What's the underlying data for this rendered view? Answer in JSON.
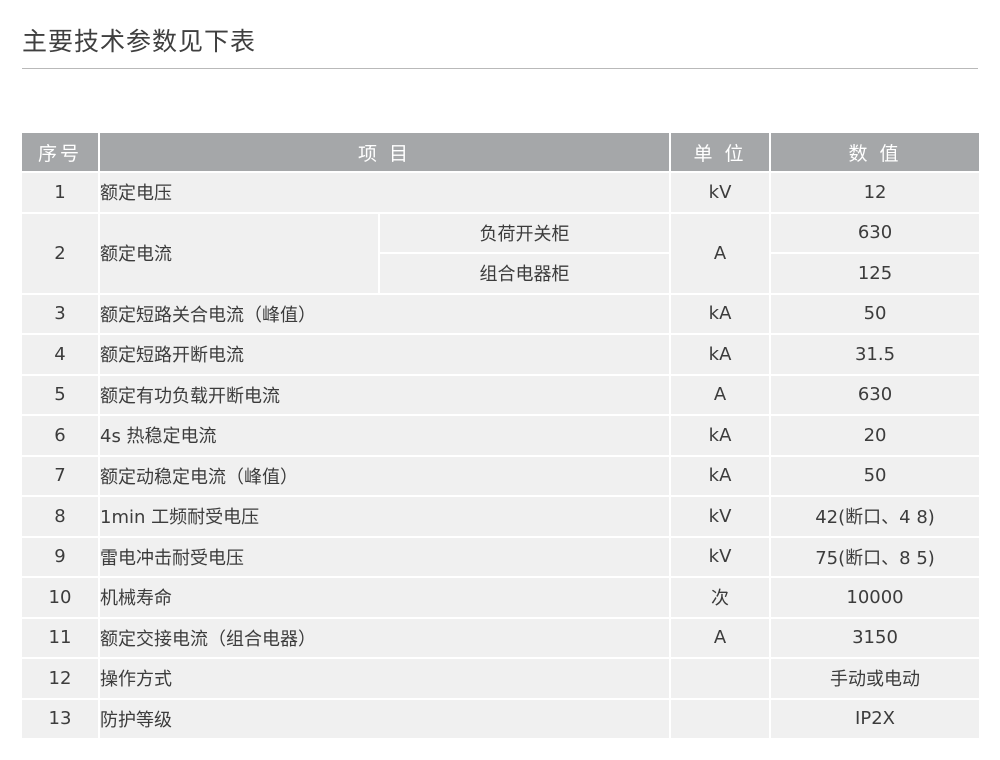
{
  "page": {
    "title": "主要技术参数见下表"
  },
  "table": {
    "headers": {
      "no": "序号",
      "item": "项 目",
      "unit": "单 位",
      "value": "数 值"
    },
    "rows": [
      {
        "no": "1",
        "item": "额定电压",
        "unit": "kV",
        "value": "12"
      },
      {
        "no": "2",
        "item": "额定电流",
        "unit": "A",
        "subs": [
          {
            "label": "负荷开关柜",
            "value": "630"
          },
          {
            "label": "组合电器柜",
            "value": "125"
          }
        ]
      },
      {
        "no": "3",
        "item": "额定短路关合电流（峰值）",
        "unit": "kA",
        "value": "50"
      },
      {
        "no": "4",
        "item": "额定短路开断电流",
        "unit": "kA",
        "value": "31.5"
      },
      {
        "no": "5",
        "item": "额定有功负载开断电流",
        "unit": "A",
        "value": "630"
      },
      {
        "no": "6",
        "item": "4s 热稳定电流",
        "unit": "kA",
        "value": "20"
      },
      {
        "no": "7",
        "item": "额定动稳定电流（峰值）",
        "unit": "kA",
        "value": "50"
      },
      {
        "no": "8",
        "item": "1min 工频耐受电压",
        "unit": "kV",
        "value": "42(断口、4 8)"
      },
      {
        "no": "9",
        "item": "雷电冲击耐受电压",
        "unit": "kV",
        "value": "75(断口、8 5)"
      },
      {
        "no": "10",
        "item": "机械寿命",
        "unit": "次",
        "value": "10000"
      },
      {
        "no": "11",
        "item": "额定交接电流（组合电器）",
        "unit": "A",
        "value": "3150"
      },
      {
        "no": "12",
        "item": "操作方式",
        "unit": "",
        "value": "手动或电动"
      },
      {
        "no": "13",
        "item": "防护等级",
        "unit": "",
        "value": "IP2X"
      }
    ]
  }
}
